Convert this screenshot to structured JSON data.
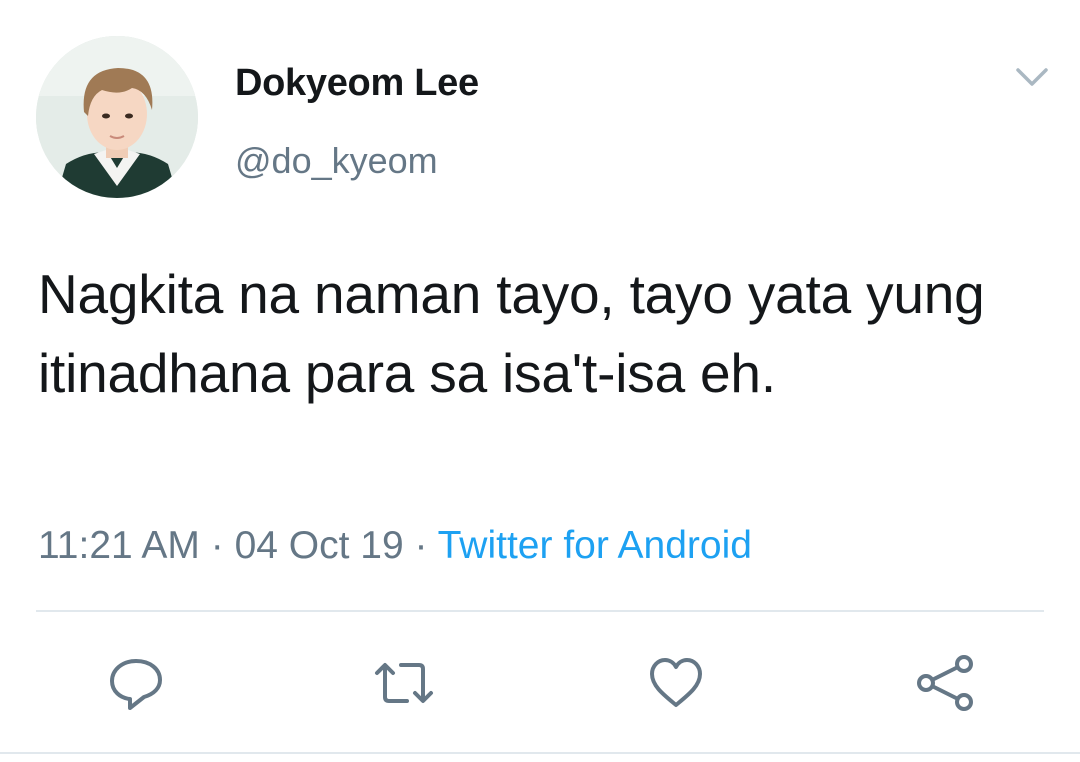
{
  "tweet": {
    "display_name": "Dokyeom Lee",
    "handle": "@do_kyeom",
    "text": "Nagkita na naman tayo, tayo yata yung itinadhana para sa isa't-isa eh.",
    "time": "11:21 AM",
    "separator": " · ",
    "date": "04 Oct 19",
    "source": "Twitter for Android"
  },
  "icons": {
    "menu": "chevron-down-icon",
    "reply": "reply-icon",
    "retweet": "retweet-icon",
    "like": "heart-icon",
    "share": "share-icon"
  },
  "colors": {
    "text": "#14171a",
    "secondary": "#657786",
    "link": "#1da1f2",
    "divider": "#e1e8ed"
  }
}
